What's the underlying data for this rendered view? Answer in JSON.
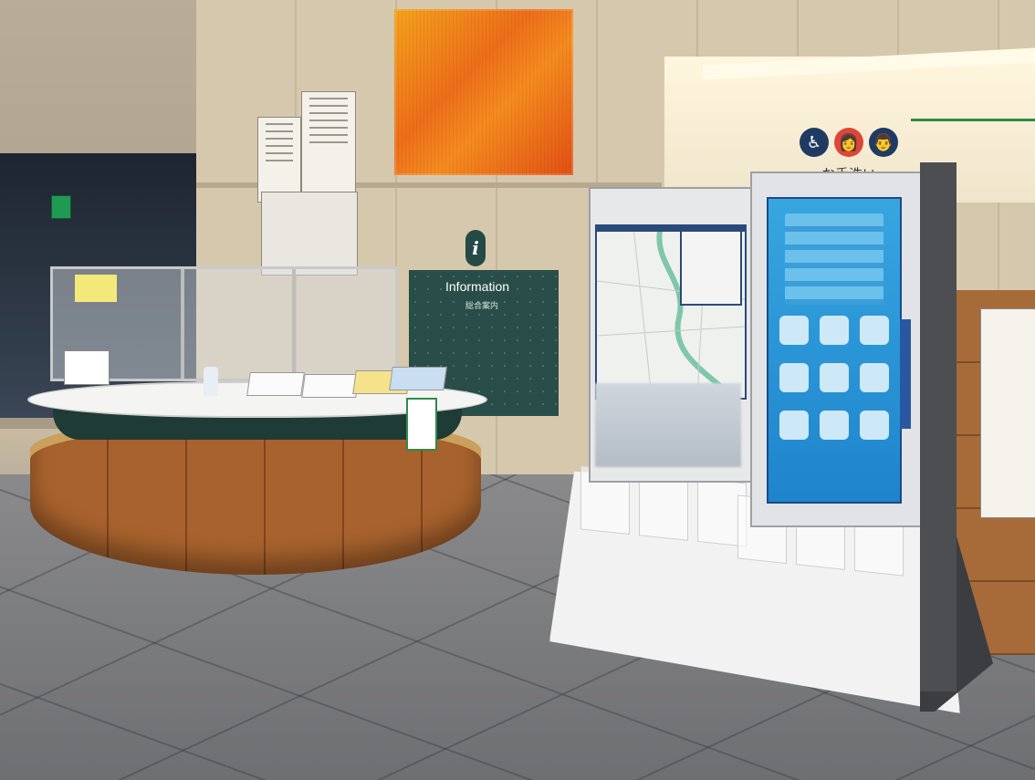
{
  "scene": {
    "information_sign": {
      "title": "Information",
      "subtitle": "総合案内",
      "icon": "info-icon"
    },
    "restroom_sign": {
      "label": "お手洗い",
      "icons": [
        "wheelchair-icon",
        "woman-icon",
        "man-icon"
      ],
      "colors": {
        "wheelchair": "#1f3b63",
        "woman": "#e0453a",
        "man": "#1f3b63"
      }
    },
    "kiosk": {
      "screen_color": "#2b96d8"
    },
    "colors": {
      "artwork": "#ee6e1a",
      "info_panel": "#294d48",
      "desk_wood": "#a8622d"
    }
  }
}
